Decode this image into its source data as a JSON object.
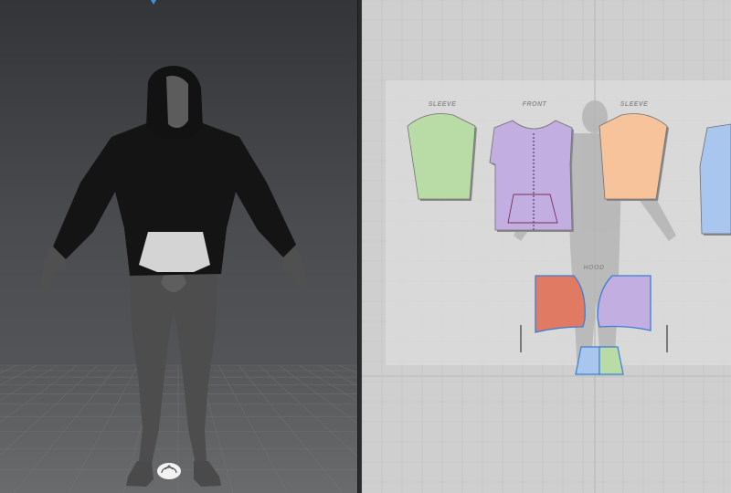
{
  "pattern_window": {
    "pieces": {
      "sleeve_left": {
        "label": "SLEEVE",
        "color": "#b9dca6"
      },
      "front": {
        "label": "FRONT",
        "color": "#c2aee0"
      },
      "sleeve_right": {
        "label": "SLEEVE",
        "color": "#f6c39a"
      },
      "back_partial": {
        "color": "#a9c6ee"
      },
      "hood_left": {
        "color": "#e07a62"
      },
      "hood_right": {
        "color": "#c2aee0"
      },
      "hood_label": "HOOD",
      "pocket": {
        "left_color": "#a9c6ee",
        "right_color": "#b9dca6"
      }
    }
  },
  "viewport_3d": {
    "avatar_garment": "hoodie",
    "garment_color": "#141414",
    "pocket_color": "#d4d4d4",
    "gizmo_icon": "rotate-gizmo-icon",
    "top_axis_icon": "axis-arrow-icon"
  },
  "colors": {
    "viewport_bg_top": "#333538",
    "pattern_bg": "#cfcfcf",
    "outline_selected": "#3a7fd5"
  }
}
